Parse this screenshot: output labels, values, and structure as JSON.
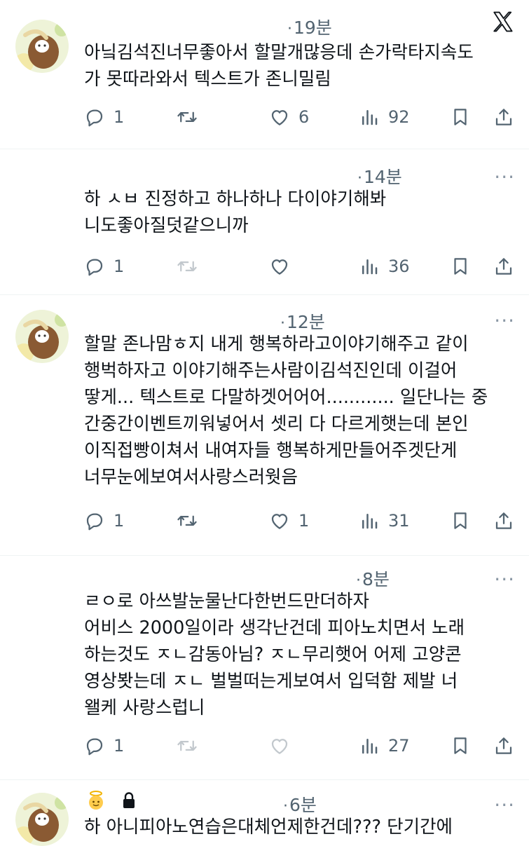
{
  "app": {
    "brand_icon": "x-logo-icon"
  },
  "tweets": [
    {
      "time": "19분",
      "has_avatar": true,
      "text": "아닠김석진너무좋아서 할말개많응데 손가락타지속도\n가 못따라와서 텍스트가 존니밀림",
      "reply_count": "1",
      "retweet_count": "",
      "like_count": "6",
      "view_count": "92"
    },
    {
      "time": "14분",
      "has_avatar": false,
      "text": "하 ㅅㅂ 진정하고 하나하나 다이야기해봐\n니도좋아질덧같으니까",
      "reply_count": "1",
      "retweet_count": "",
      "like_count": "",
      "view_count": "36"
    },
    {
      "time": "12분",
      "has_avatar": true,
      "text": "할말 존나맘ㅎ지 내게 행복하라고이야기해주고 같이\n행벅하자고 이야기해주는사람이김석진인데 이걸어\n땋게... 텍스트로 다말하겟어어어............ 일단나는 중\n간중간이벤트끼워넣어서 셋리 다 다르게햇는데 본인\n이직접빵이쳐서 내여자들 행복하게만들어주겟단게\n너무눈에보여서사랑스러웟음",
      "reply_count": "1",
      "retweet_count": "",
      "like_count": "1",
      "view_count": "31"
    },
    {
      "time": "8분",
      "has_avatar": false,
      "text": "ㄹㅇ로 아쓰발눈물난다한번드만더하자\n어비스 2000일이라 생각난건데 피아노치면서 노래\n하는것도 ㅈㄴ감동아님? ㅈㄴ무리햇어 어제 고양콘\n영상봣는데 ㅈㄴ 벌벌떠는게보여서 입덕함 제발 너\n왤케 사랑스럽니",
      "reply_count": "1",
      "retweet_count": "",
      "like_count": "",
      "view_count": "27"
    },
    {
      "time": "6분",
      "has_avatar": true,
      "text": "하 아니피아노연습은대체언제한건데??? 단기간에",
      "badges": [
        "angel-emoji",
        "lock-icon"
      ]
    }
  ]
}
